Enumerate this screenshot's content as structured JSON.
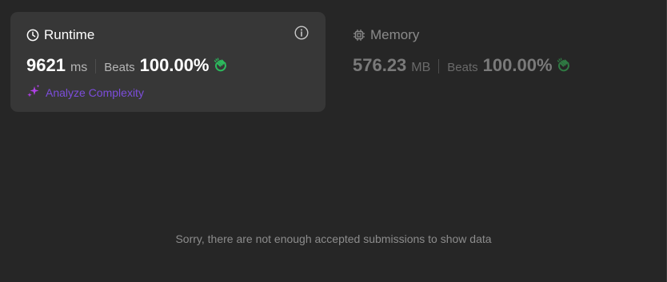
{
  "runtime": {
    "title": "Runtime",
    "value": "9621",
    "unit": "ms",
    "beats_label": "Beats",
    "beats_pct": "100.00%",
    "analyze_label": "Analyze Complexity"
  },
  "memory": {
    "title": "Memory",
    "value": "576.23",
    "unit": "MB",
    "beats_label": "Beats",
    "beats_pct": "100.00%"
  },
  "message": "Sorry, there are not enough accepted submissions to show data",
  "colors": {
    "background": "#262626",
    "card_active": "#373737",
    "accent_purple": "#7c4ddb",
    "clap_green": "#2cbb5d"
  },
  "icons": {
    "runtime": "clock-icon",
    "memory": "chip-icon",
    "info": "info-icon",
    "analyze": "sparkle-icon",
    "beats": "clap-icon"
  }
}
